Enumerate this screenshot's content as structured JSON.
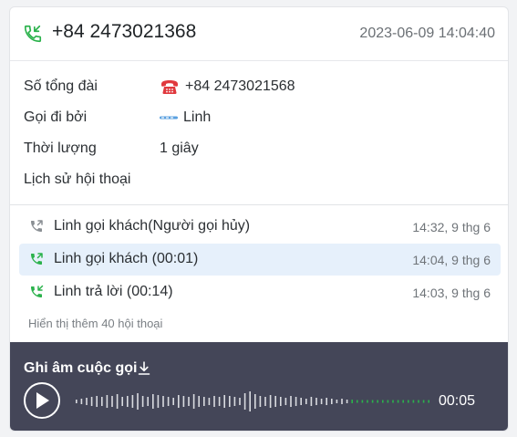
{
  "header": {
    "phone_number": "+84 2473021368",
    "timestamp": "2023-06-09 14:04:40",
    "icon": "phone-incoming-icon"
  },
  "details": {
    "hotline_label": "Số tổng đài",
    "hotline_value": "+84 2473021568",
    "hotline_icon": "telephone-icon",
    "caller_label": "Gọi đi bởi",
    "caller_value": "Linh",
    "caller_icon": "subiz-logo-icon",
    "duration_label": "Thời lượng",
    "duration_value": "1 giây",
    "history_label": "Lịch sử hội thoại"
  },
  "history": [
    {
      "text": "Linh gọi khách(Người gọi hủy)",
      "time": "14:32, 9 thg 6",
      "icon": "phone-outgoing-icon",
      "color": "#8a8f94",
      "active": false
    },
    {
      "text": "Linh gọi khách (00:01)",
      "time": "14:04, 9 thg 6",
      "icon": "phone-outgoing-icon",
      "color": "#2bb24c",
      "active": true
    },
    {
      "text": "Linh trả lời (00:14)",
      "time": "14:03, 9 thg 6",
      "icon": "phone-incoming-icon",
      "color": "#2bb24c",
      "active": false
    }
  ],
  "more_link": "Hiển thị thêm 40 hội thoại",
  "recording": {
    "title": "Ghi âm cuộc gọi",
    "duration": "00:05",
    "progress": 0,
    "colors": {
      "background": "#444658",
      "wave": "#d9dbe0",
      "wave_tail": "#2bb24c"
    }
  },
  "colors": {
    "accent_green": "#2bb24c",
    "active_row": "#e6f0fb"
  }
}
